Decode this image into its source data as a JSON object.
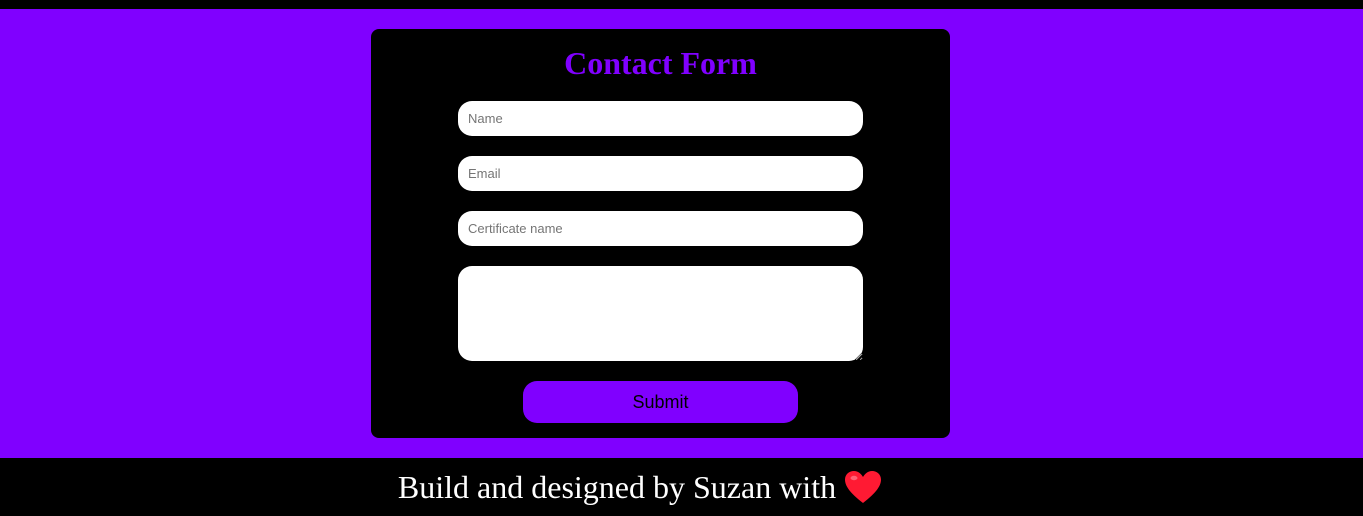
{
  "form": {
    "title": "Contact Form",
    "fields": {
      "name_placeholder": "Name",
      "email_placeholder": "Email",
      "certificate_placeholder": "Certificate name",
      "message_placeholder": ""
    },
    "submit_label": "Submit"
  },
  "footer": {
    "text": "Build and designed by Suzan with",
    "icon": "heart-icon"
  },
  "colors": {
    "accent": "#8000ff",
    "card": "#000000",
    "field": "#ffffff",
    "heart": "#ff1a33"
  }
}
